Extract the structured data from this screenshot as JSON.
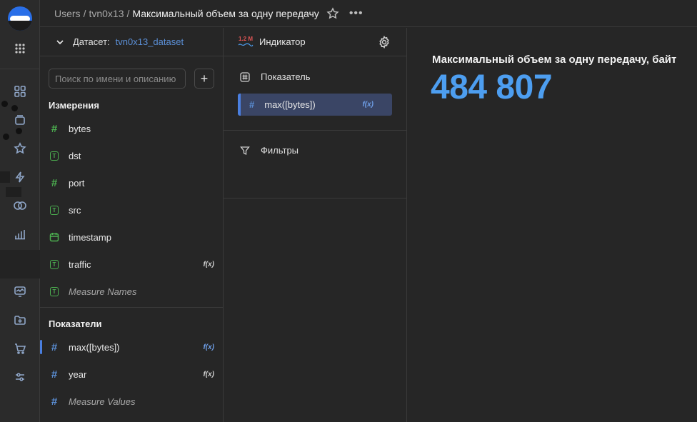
{
  "breadcrumb": {
    "root": "Users",
    "folder": "tvn0x13",
    "current": "Максимальный объем за одну передачу",
    "separator": "/"
  },
  "dataset": {
    "label": "Датасет:",
    "name": "tvn0x13_dataset"
  },
  "search": {
    "placeholder": "Поиск по имени и описанию"
  },
  "dimensions": {
    "title": "Измерения",
    "items": [
      {
        "label": "bytes",
        "type": "number"
      },
      {
        "label": "dst",
        "type": "text"
      },
      {
        "label": "port",
        "type": "number"
      },
      {
        "label": "src",
        "type": "text"
      },
      {
        "label": "timestamp",
        "type": "date"
      },
      {
        "label": "traffic",
        "type": "text",
        "fx": "f(x)"
      },
      {
        "label": "Measure Names",
        "type": "text"
      }
    ]
  },
  "measures": {
    "title": "Показатели",
    "items": [
      {
        "label": "max([bytes])",
        "fx": "f(x)",
        "selected": true
      },
      {
        "label": "year",
        "fx": "f(x)"
      },
      {
        "label": "Measure Values"
      }
    ]
  },
  "viz": {
    "badge": "1.2 M",
    "type_label": "Индикатор",
    "measure_section": "Показатель",
    "measure_chip": "max([bytes])",
    "measure_chip_fx": "f(x)",
    "filters_section": "Фильтры"
  },
  "preview": {
    "title": "Максимальный объем за одну передачу, байт",
    "value": "484 807"
  },
  "colors": {
    "accent": "#4d9ef0",
    "number_icon": "#4caf50",
    "measure_icon": "#5b8fd6",
    "selected_chip": "#3a4565",
    "badge_red": "#e05555"
  },
  "icons": [
    "home-icon",
    "apps-grid-icon",
    "collections-icon",
    "star-icon",
    "bolt-icon",
    "datasets-icon",
    "charts-icon",
    "dashboards-icon",
    "monitor-icon",
    "folder-icon",
    "cart-icon",
    "settings-sliders-icon"
  ]
}
